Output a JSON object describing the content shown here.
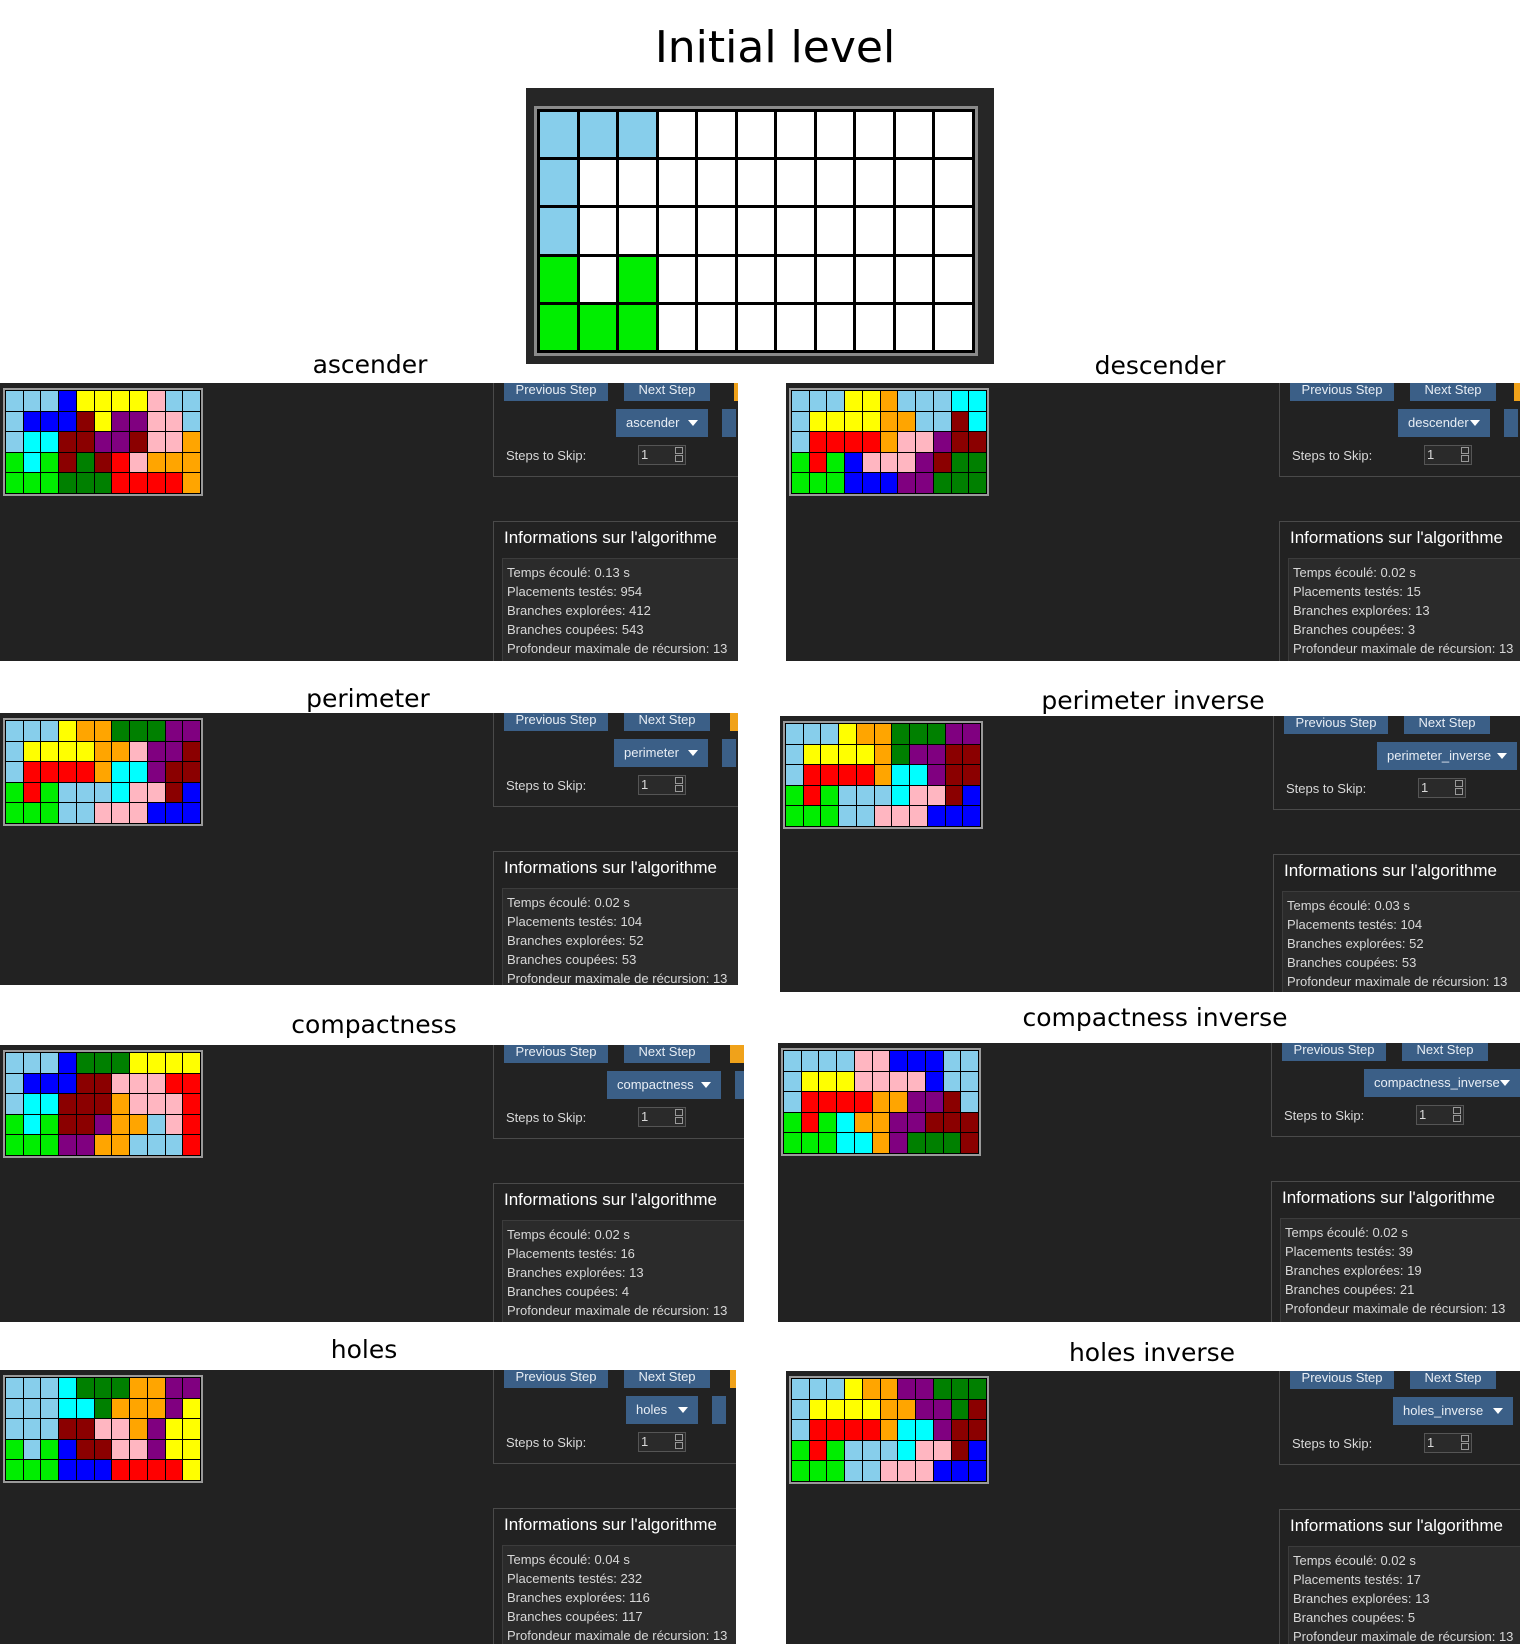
{
  "title": "Initial level",
  "colors": {
    "W": "#ffffff",
    "L": "#87ceeb",
    "G": "#00ee00",
    "D": "#008000",
    "B": "#0000ff",
    "C": "#00ffff",
    "Y": "#ffff00",
    "O": "#ffa500",
    "P": "#800080",
    "K": "#ffb6c1",
    "M": "#8b0000",
    "R": "#ff0000"
  },
  "initial_grid": [
    "LLLWWWWWWWW",
    "LWWWWWWWWWW",
    "LWWWWWWWWWW",
    "GWGWWWWWWWW",
    "GGGWWWWWWWW"
  ],
  "labels": {
    "prev": "Previous Step",
    "next": "Next Step",
    "steps": "Steps to Skip:",
    "info_title": "Informations sur l'algorithme"
  },
  "info_labels": {
    "time": "Temps écoulé:",
    "placements": "Placements testés:",
    "explored": "Branches explorées:",
    "cut": "Branches coupées:",
    "depth": "Profondeur maximale de récursion:"
  },
  "panels": [
    {
      "title": "ascender",
      "algorithm": "ascender",
      "steps": "1",
      "grid": [
        "LLLBYYYYKLL",
        "LBBBMYPPKKL",
        "LCCMMPPMKKO",
        "GCGMDMRKOOO",
        "GGGDDDRRRRO"
      ],
      "info": {
        "time": "0.13 s",
        "placements": "954",
        "explored": "412",
        "cut": "543",
        "depth": "13"
      }
    },
    {
      "title": "descender",
      "algorithm": "descender",
      "steps": "1",
      "grid": [
        "LLLYYOLLLCC",
        "LYYYYOOLLMC",
        "LRRRROKKPMM",
        "GRGBKKKPMDD",
        "GGGBBBPPDDD"
      ],
      "info": {
        "time": "0.02 s",
        "placements": "15",
        "explored": "13",
        "cut": "3",
        "depth": "13"
      }
    },
    {
      "title": "perimeter",
      "algorithm": "perimeter",
      "steps": "1",
      "grid": [
        "LLLYOODDDPP",
        "LYYYYOOKPPM",
        "LRRRROCCPMM",
        "GRGLLLCKKMB",
        "GGGLLKKKBBB"
      ],
      "info": {
        "time": "0.02 s",
        "placements": "104",
        "explored": "52",
        "cut": "53",
        "depth": "13"
      }
    },
    {
      "title": "perimeter inverse",
      "algorithm": "perimeter_inverse",
      "steps": "1",
      "grid": [
        "LLLYOODDDPP",
        "LYYYYODPPMM",
        "LRRRROCCPMM",
        "GRGLLLCKKMB",
        "GGGLLKKKBBB"
      ],
      "info": {
        "time": "0.03 s",
        "placements": "104",
        "explored": "52",
        "cut": "53",
        "depth": "13"
      }
    },
    {
      "title": "compactness",
      "algorithm": "compactness",
      "steps": "1",
      "grid": [
        "LLLBDDDYYYY",
        "LBBBMMKKKRR",
        "LCCMMMOKKKR",
        "GCGMMPOOLKR",
        "GGGPPOOLLLR"
      ],
      "info": {
        "time": "0.02 s",
        "placements": "16",
        "explored": "13",
        "cut": "4",
        "depth": "13"
      }
    },
    {
      "title": "compactness inverse",
      "algorithm": "compactness_inverse",
      "steps": "1",
      "grid": [
        "LLLLKKBBBLL",
        "LYYYKKKKBLL",
        "LRRRROOPPML",
        "GRGCOOPPMMM",
        "GGGCCOPDDDM"
      ],
      "info": {
        "time": "0.02 s",
        "placements": "39",
        "explored": "19",
        "cut": "21",
        "depth": "13"
      }
    },
    {
      "title": "holes",
      "algorithm": "holes",
      "steps": "1",
      "grid": [
        "LLLCDDDOOPP",
        "LLLCCDOOOPY",
        "LLLMMKKOPYY",
        "GLGBMMKKPYY",
        "GGGBBBRRRRY"
      ],
      "info": {
        "time": "0.04 s",
        "placements": "232",
        "explored": "116",
        "cut": "117",
        "depth": "13"
      }
    },
    {
      "title": "holes inverse",
      "algorithm": "holes_inverse",
      "steps": "1",
      "grid": [
        "LLLYOOPPDDD",
        "LYYYYOOPPDM",
        "LRRRROCCPMM",
        "GRGLLLCKKMB",
        "GGGLLKKKBBB"
      ],
      "info": {
        "time": "0.02 s",
        "placements": "17",
        "explored": "13",
        "cut": "5",
        "depth": "13"
      }
    }
  ]
}
